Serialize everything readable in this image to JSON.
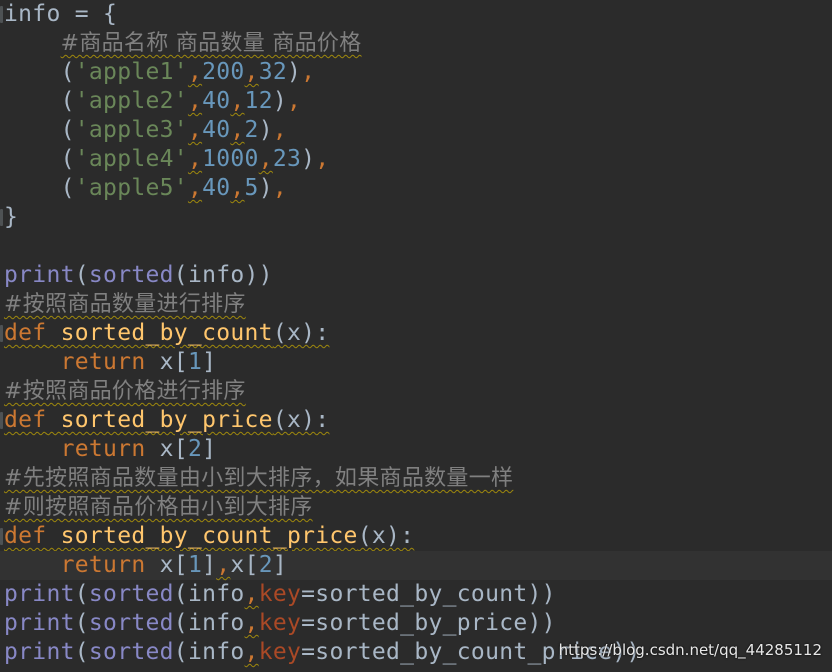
{
  "editor": {
    "lines": {
      "l0": {
        "a": "info = {"
      },
      "l1": {
        "a": "#商品名称 商品数量 商品价格"
      },
      "l2": {
        "p1": "(",
        "s": "'apple1'",
        "c1": ",",
        "n1": "200",
        "c2": ",",
        "n2": "32",
        "p2": ")",
        "c3": ","
      },
      "l3": {
        "p1": "(",
        "s": "'apple2'",
        "c1": ",",
        "n1": "40",
        "c2": ",",
        "n2": "12",
        "p2": ")",
        "c3": ","
      },
      "l4": {
        "p1": "(",
        "s": "'apple3'",
        "c1": ",",
        "n1": "40",
        "c2": ",",
        "n2": "2",
        "p2": ")",
        "c3": ","
      },
      "l5": {
        "p1": "(",
        "s": "'apple4'",
        "c1": ",",
        "n1": "1000",
        "c2": ",",
        "n2": "23",
        "p2": ")",
        "c3": ","
      },
      "l6": {
        "p1": "(",
        "s": "'apple5'",
        "c1": ",",
        "n1": "40",
        "c2": ",",
        "n2": "5",
        "p2": ")",
        "c3": ","
      },
      "l7": {
        "a": "}"
      },
      "l9": {
        "b1": "print",
        "p1": "(",
        "b2": "sorted",
        "p2": "(info))"
      },
      "l10": {
        "a": "#按照商品数量进行排序"
      },
      "l11": {
        "k": "def",
        "sp": " ",
        "f": "sorted_by_count",
        "p1": "(x):"
      },
      "l12": {
        "k": "return",
        "t1": " x[",
        "n": "1",
        "t2": "]"
      },
      "l13": {
        "a": "#按照商品价格进行排序"
      },
      "l14": {
        "k": "def",
        "sp": " ",
        "f": "sorted_by_price",
        "p1": "(x):"
      },
      "l15": {
        "k": "return",
        "t1": " x[",
        "n": "2",
        "t2": "]"
      },
      "l16": {
        "a": "#先按照商品数量由小到大排序，如果商品数量一样"
      },
      "l17": {
        "a": "#则按照商品价格由小到大排序"
      },
      "l18": {
        "k": "def",
        "sp": " ",
        "f": "sorted_by_count_price",
        "p1": "(x):"
      },
      "l19": {
        "k": "return",
        "t1": " x[",
        "n1": "1",
        "t2": "]",
        "c": ",",
        "t3": "x[",
        "n2": "2",
        "t4": "]"
      },
      "l20": {
        "b1": "print",
        "p1": "(",
        "b2": "sorted",
        "p2": "(info",
        "c": ",",
        "pm": "key",
        "t": "=sorted_by_count))"
      },
      "l21": {
        "b1": "print",
        "p1": "(",
        "b2": "sorted",
        "p2": "(info",
        "c": ",",
        "pm": "key",
        "t": "=sorted_by_price))"
      },
      "l22": {
        "b1": "print",
        "p1": "(",
        "b2": "sorted",
        "p2": "(info",
        "c": ",",
        "pm": "key",
        "t": "=sorted_by_count_price))"
      }
    }
  },
  "watermark": "https://blog.csdn.net/qq_44285112",
  "colors": {
    "background": "#2b2b2b",
    "keyword": "#cc7832",
    "function": "#ffc66d",
    "builtin": "#8888c6",
    "string": "#6a8759",
    "number": "#6897bb",
    "comment": "#808080",
    "param": "#aa4926",
    "text": "#a9b7c6"
  }
}
